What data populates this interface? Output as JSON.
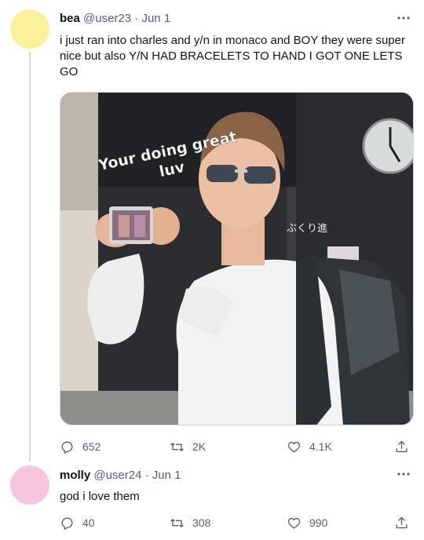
{
  "tweets": [
    {
      "display_name": "bea",
      "handle": "@user23",
      "date": "Jun 1",
      "avatar_color": "#fbf19a",
      "text": "i just ran into charles and y/n in monaco and BOY they were super nice but also Y/N HAD BRACELETS TO HAND I GOT ONE LETS GO",
      "media": {
        "overlay_line1": "Your doing great",
        "overlay_line2": "luv",
        "sign_text": "ぶくり進"
      },
      "stats": {
        "replies": "652",
        "retweets": "2K",
        "likes": "4.1K"
      }
    },
    {
      "display_name": "molly",
      "handle": "@user24",
      "date": "Jun 1",
      "avatar_color": "#f7c6de",
      "text": "god i love them",
      "stats": {
        "replies": "40",
        "retweets": "308",
        "likes": "990"
      }
    }
  ],
  "colors": {
    "text": "#0f1419",
    "muted": "#536471",
    "divider": "#cfd9de"
  },
  "icons": [
    "reply-icon",
    "retweet-icon",
    "like-icon",
    "share-icon",
    "more-icon"
  ]
}
